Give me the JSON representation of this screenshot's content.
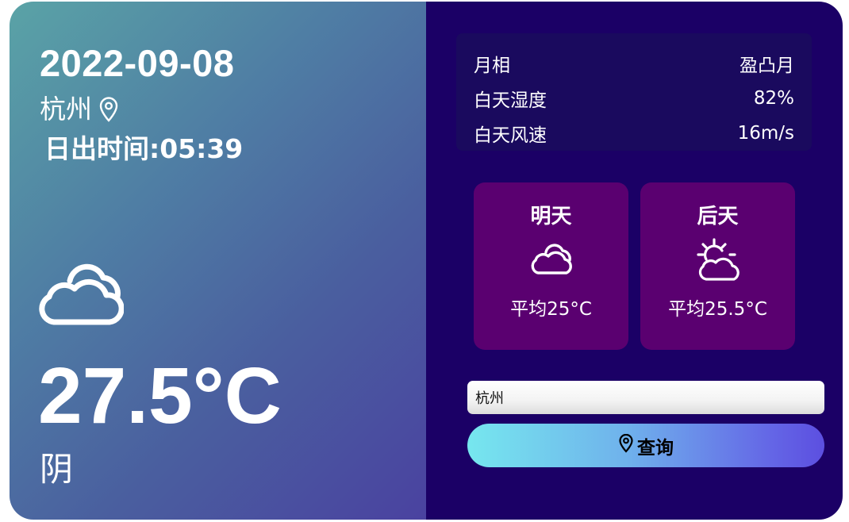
{
  "today": {
    "date": "2022-09-08",
    "city": "杭州",
    "sunrise": "日出时间:05:39",
    "temperature": "27.5°C",
    "condition": "阴",
    "icon": "cloud-icon"
  },
  "details": [
    {
      "label": "月相",
      "value": "盈凸月"
    },
    {
      "label": "白天湿度",
      "value": "82%"
    },
    {
      "label": "白天风速",
      "value": "16m/s"
    }
  ],
  "forecast": [
    {
      "day": "明天",
      "avg": "平均25°C",
      "icon": "cloud-icon"
    },
    {
      "day": "后天",
      "avg": "平均25.5°C",
      "icon": "sun-behind-cloud-icon"
    }
  ],
  "search": {
    "value": "杭州",
    "button_label": "查询",
    "button_icon": "location-pin-icon"
  },
  "colors": {
    "left_gradient_start": "#5aa3a6",
    "left_gradient_end": "#4a42a0",
    "right_background": "#1b0066",
    "info_box": "#1a0a5e",
    "forecast_card": "#5a0070",
    "button_gradient_start": "#76e7ee",
    "button_gradient_end": "#5c4fe0"
  }
}
